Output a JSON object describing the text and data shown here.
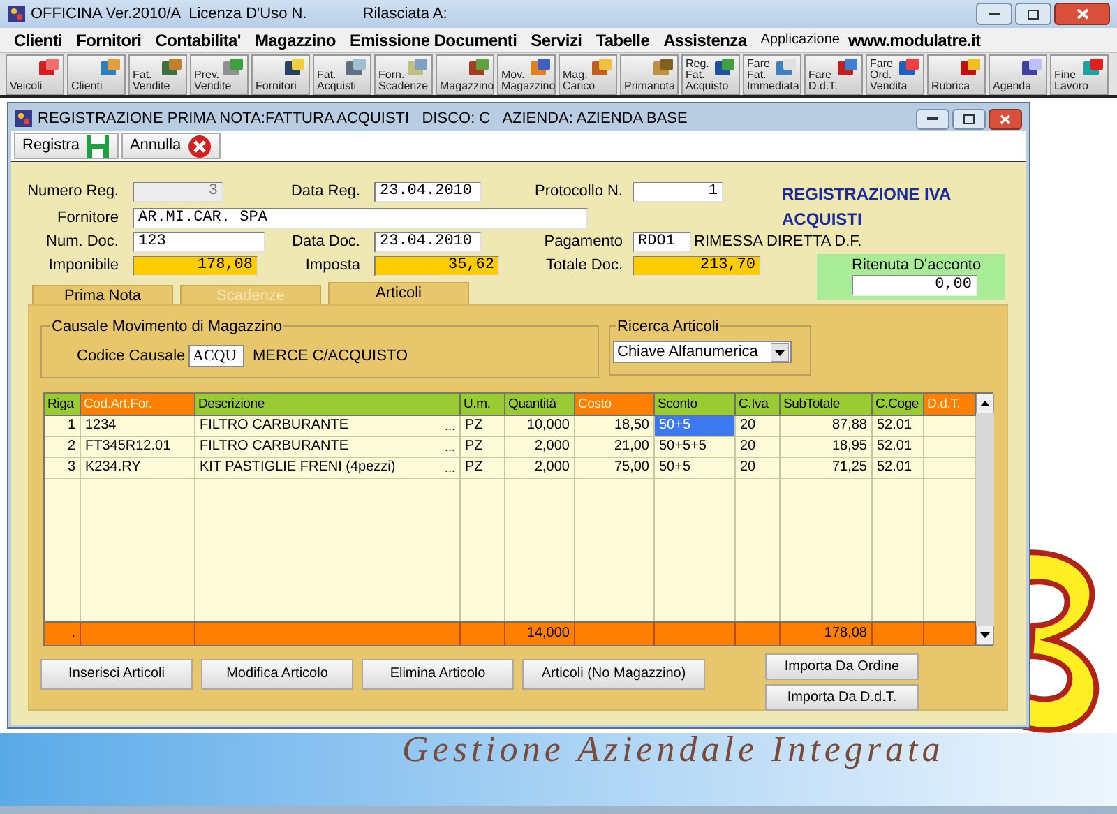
{
  "app_window": {
    "title": "OFFICINA Ver.2010/A  Licenza D'Uso N.",
    "licensee_label": "Rilasciata A:"
  },
  "menu": {
    "items": [
      "Clienti",
      "Fornitori",
      "Contabilita'",
      "Magazzino",
      "Emissione Documenti",
      "Servizi",
      "Tabelle",
      "Assistenza"
    ],
    "application_label": "Applicazione",
    "website": "www.modulatre.it"
  },
  "toolbar": [
    {
      "label": "Veicoli"
    },
    {
      "label": "Clienti"
    },
    {
      "label": "Fat.\nVendite"
    },
    {
      "label": "Prev.\nVendite"
    },
    {
      "label": "Fornitori"
    },
    {
      "label": "Fat.\nAcquisti"
    },
    {
      "label": "Forn.\nScadenze"
    },
    {
      "label": "Magazzino"
    },
    {
      "label": "Mov.\nMagazzino"
    },
    {
      "label": "Mag.\nCarico"
    },
    {
      "label": "Primanota"
    },
    {
      "label": "Reg.\nFat.\nAcquisto"
    },
    {
      "label": "Fare\nFat.\nImmediata"
    },
    {
      "label": "Fare\nD.d.T."
    },
    {
      "label": "Fare\nOrd.\nVendita"
    },
    {
      "label": "Rubrica"
    },
    {
      "label": "Agenda"
    },
    {
      "label": "Fine\nLavoro"
    }
  ],
  "background": {
    "tagline": "Gestione Aziendale Integrata"
  },
  "dialog": {
    "title": "REGISTRAZIONE PRIMA NOTA:FATTURA ACQUISTI   DISCO: C   AZIENDA: AZIENDA BASE",
    "actions": [
      {
        "label": "Registra",
        "kind": "save"
      },
      {
        "label": "Annulla",
        "kind": "cancel"
      }
    ],
    "form": {
      "numero_reg": {
        "label": "Numero Reg.",
        "value": "3",
        "disabled": true
      },
      "data_reg": {
        "label": "Data Reg.",
        "value": "23.04.2010"
      },
      "protocollo": {
        "label": "Protocollo N.",
        "value": "1"
      },
      "fornitore": {
        "label": "Fornitore",
        "value": "AR.MI.CAR. SPA"
      },
      "num_doc": {
        "label": "Num. Doc.",
        "value": "123"
      },
      "data_doc": {
        "label": "Data Doc.",
        "value": "23.04.2010"
      },
      "pagamento": {
        "label": "Pagamento",
        "value": "RDO1",
        "description": "RIMESSA DIRETTA D.F."
      },
      "imponibile": {
        "label": "Imponibile",
        "value": "178,08"
      },
      "imposta": {
        "label": "Imposta",
        "value": "35,62"
      },
      "totale_doc": {
        "label": "Totale Doc.",
        "value": "213,70"
      }
    },
    "heading": "REGISTRAZIONE IVA ACQUISTI",
    "withholding": {
      "label": "Ritenuta D'acconto",
      "value": "0,00"
    },
    "tabs": [
      {
        "label": "Prima Nota",
        "selected": false,
        "disabled": false
      },
      {
        "label": "Scadenze",
        "selected": false,
        "disabled": true
      },
      {
        "label": "Articoli",
        "selected": true,
        "disabled": false
      }
    ],
    "movement_group": {
      "title": "Causale Movimento di Magazzino",
      "code_label": "Codice Causale",
      "code": "ACQU",
      "description": "MERCE C/ACQUISTO"
    },
    "search_group": {
      "title": "Ricerca Articoli",
      "value": "Chiave Alfanumerica"
    },
    "table": {
      "columns": [
        {
          "label": "Riga",
          "color": "#99cc33"
        },
        {
          "label": "Cod.Art.For.",
          "color": "#ff8000"
        },
        {
          "label": "Descrizione",
          "color": "#99cc33"
        },
        {
          "label": "U.m.",
          "color": "#99cc33"
        },
        {
          "label": "Quantità",
          "color": "#99cc33"
        },
        {
          "label": "Costo",
          "color": "#ff8000"
        },
        {
          "label": "Sconto",
          "color": "#99cc33"
        },
        {
          "label": "C.Iva",
          "color": "#99cc33"
        },
        {
          "label": "SubTotale",
          "color": "#99cc33"
        },
        {
          "label": "C.Coge",
          "color": "#99cc33"
        },
        {
          "label": "D.d.T.",
          "color": "#ff8000"
        }
      ],
      "rows": [
        {
          "cells": [
            "1",
            "1234",
            "FILTRO CARBURANTE",
            "PZ",
            "10,000",
            "18,50",
            "50+5",
            "20",
            "87,88",
            "52.01",
            ""
          ],
          "lookup": "...",
          "sconto_selected": true
        },
        {
          "cells": [
            "2",
            "FT345R12.01",
            "FILTRO CARBURANTE",
            "PZ",
            "2,000",
            "21,00",
            "50+5+5",
            "20",
            "18,95",
            "52.01",
            ""
          ],
          "lookup": "...",
          "sconto_selected": false
        },
        {
          "cells": [
            "3",
            "K234.RY",
            "KIT PASTIGLIE FRENI (4pezzi)",
            "PZ",
            "2,000",
            "75,00",
            "50+5",
            "20",
            "71,25",
            "52.01",
            ""
          ],
          "lookup": "...",
          "sconto_selected": false
        }
      ],
      "totals": {
        "riga": ".",
        "quantita": "14,000",
        "subtotale": "178,08"
      }
    },
    "buttons": [
      "Inserisci Articoli",
      "Modifica Articolo",
      "Elimina Articolo",
      "Articoli (No Magazzino)"
    ],
    "import_buttons": [
      "Importa Da Ordine",
      "Importa Da D.d.T."
    ]
  }
}
